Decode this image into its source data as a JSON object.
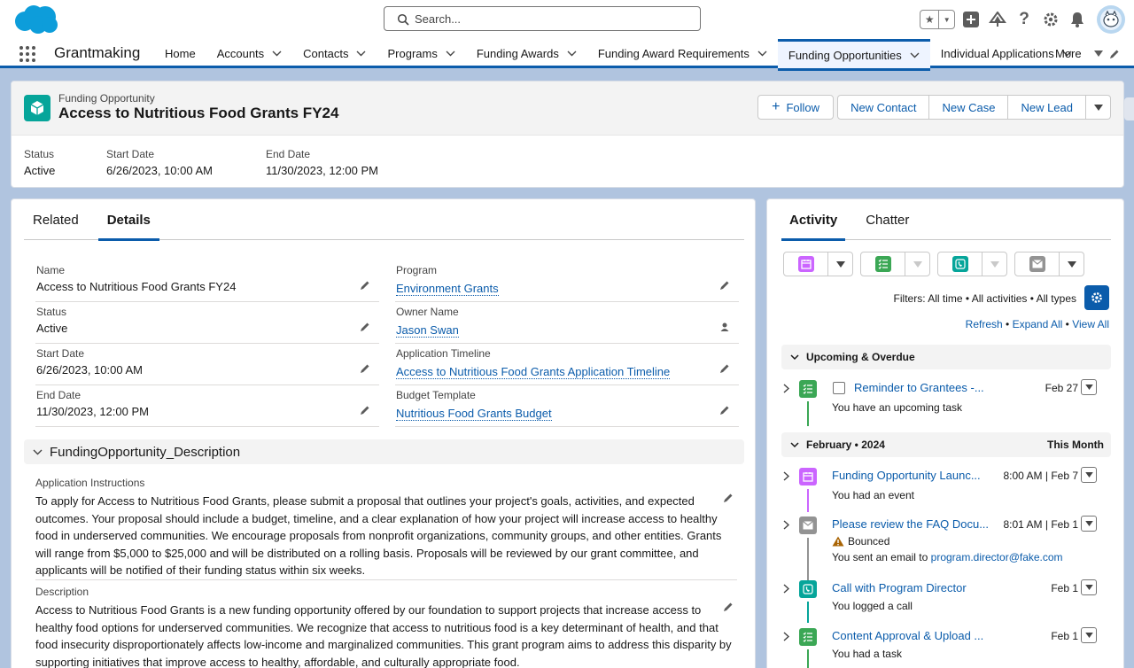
{
  "header": {
    "search_placeholder": "Search..."
  },
  "nav": {
    "app_name": "Grantmaking",
    "tabs": [
      {
        "label": "Home",
        "chevron": false
      },
      {
        "label": "Accounts",
        "chevron": true
      },
      {
        "label": "Contacts",
        "chevron": true
      },
      {
        "label": "Programs",
        "chevron": true
      },
      {
        "label": "Funding Awards",
        "chevron": true
      },
      {
        "label": "Funding Award Requirements",
        "chevron": true
      },
      {
        "label": "Funding Opportunities",
        "chevron": true,
        "active": true
      },
      {
        "label": "Individual Applications",
        "chevron": true
      }
    ],
    "more": "More"
  },
  "record": {
    "type": "Funding Opportunity",
    "title": "Access to Nutritious Food Grants FY24",
    "buttons": {
      "follow": "Follow",
      "new_contact": "New Contact",
      "new_case": "New Case",
      "new_lead": "New Lead"
    },
    "highlights": [
      {
        "label": "Status",
        "value": "Active"
      },
      {
        "label": "Start Date",
        "value": "6/26/2023, 10:00 AM"
      },
      {
        "label": "End Date",
        "value": "11/30/2023, 12:00 PM"
      }
    ]
  },
  "details": {
    "tabs": [
      "Related",
      "Details"
    ],
    "left": [
      {
        "label": "Name",
        "value": "Access to Nutritious Food Grants FY24"
      },
      {
        "label": "Status",
        "value": "Active"
      },
      {
        "label": "Start Date",
        "value": "6/26/2023, 10:00 AM"
      },
      {
        "label": "End Date",
        "value": "11/30/2023, 12:00 PM"
      }
    ],
    "right": [
      {
        "label": "Program",
        "value": "Environment Grants"
      },
      {
        "label": "Owner Name",
        "value": "Jason Swan"
      },
      {
        "label": "Application Timeline",
        "value": "Access to Nutritious Food Grants Application Timeline"
      },
      {
        "label": "Budget Template",
        "value": "Nutritious Food Grants Budget"
      }
    ],
    "section_title": "FundingOpportunity_Description",
    "instructions_label": "Application Instructions",
    "instructions": "To apply for Access to Nutritious Food Grants, please submit a proposal that outlines your project's goals, activities, and expected outcomes. Your proposal should include a budget, timeline, and a clear explanation of how your project will increase access to healthy food in underserved communities. We encourage proposals from nonprofit organizations, community groups, and other entities. Grants will range from $5,000 to $25,000 and will be distributed on a rolling basis. Proposals will be reviewed by our grant committee, and applicants will be notified of their funding status within six weeks.",
    "description_label": "Description",
    "description": "Access to Nutritious Food Grants is a new funding opportunity offered by our foundation to support projects that increase access to healthy food options for underserved communities. We recognize that access to nutritious food is a key determinant of health, and that food insecurity disproportionately affects low-income and marginalized communities. This grant program aims to address this disparity by supporting initiatives that improve access to healthy, affordable, and culturally appropriate food."
  },
  "activity": {
    "tabs": [
      "Activity",
      "Chatter"
    ],
    "filters": "Filters: All time • All activities • All types",
    "links": {
      "refresh": "Refresh",
      "expand_all": "Expand All",
      "view_all": "View All",
      "sep": "•"
    },
    "groups": {
      "upcoming": "Upcoming & Overdue",
      "month": "February • 2024",
      "month_right": "This Month"
    },
    "upcoming_item": {
      "title": "Reminder to Grantees -...",
      "date": "Feb 27",
      "sub": "You have an upcoming task"
    },
    "items": [
      {
        "title": "Funding Opportunity Launc...",
        "date": "8:00 AM | Feb 7",
        "sub": "You had an event"
      },
      {
        "title": "Please review the FAQ Docu...",
        "date": "8:01 AM | Feb 1",
        "warning": "Bounced",
        "sub_prefix": "You sent an email to",
        "sub_link": "program.director@fake.com"
      },
      {
        "title": "Call with Program Director",
        "date": "Feb 1",
        "sub": "You logged a call"
      },
      {
        "title": "Content Approval & Upload ...",
        "date": "Feb 1",
        "sub": "You had a task"
      }
    ]
  },
  "colors": {
    "brand": "#0b5cab",
    "event": "#cb65ff",
    "task": "#3ba755",
    "call": "#06a59a",
    "email": "#939393"
  }
}
